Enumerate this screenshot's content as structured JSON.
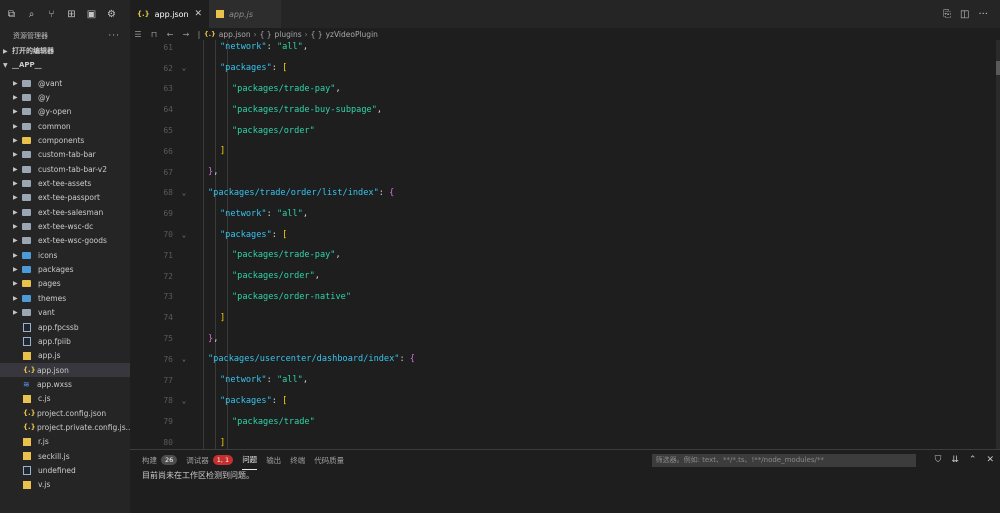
{
  "sidebar": {
    "toolbar_icons": [
      "copy-icon",
      "search-icon",
      "branch-icon",
      "extensions-icon",
      "panel-icon",
      "debug-icon"
    ],
    "header_title": "资源管理器",
    "header_more": "···",
    "open_editors_label": "打开的编辑器",
    "project_label": "__APP__",
    "items": [
      {
        "label": "@vant",
        "type": "folder",
        "color": "plain"
      },
      {
        "label": "@y",
        "type": "folder",
        "color": "plain"
      },
      {
        "label": "@y-open",
        "type": "folder",
        "color": "plain"
      },
      {
        "label": "common",
        "type": "folder",
        "color": "plain"
      },
      {
        "label": "components",
        "type": "folder",
        "color": "yellow"
      },
      {
        "label": "custom-tab-bar",
        "type": "folder",
        "color": "plain"
      },
      {
        "label": "custom-tab-bar-v2",
        "type": "folder",
        "color": "plain"
      },
      {
        "label": "ext-tee-assets",
        "type": "folder",
        "color": "plain"
      },
      {
        "label": "ext-tee-passport",
        "type": "folder",
        "color": "plain"
      },
      {
        "label": "ext-tee-salesman",
        "type": "folder",
        "color": "plain"
      },
      {
        "label": "ext-tee-wsc-dc",
        "type": "folder",
        "color": "plain"
      },
      {
        "label": "ext-tee-wsc-goods",
        "type": "folder",
        "color": "plain"
      },
      {
        "label": "icons",
        "type": "folder",
        "color": "blue"
      },
      {
        "label": "packages",
        "type": "folder",
        "color": "blue"
      },
      {
        "label": "pages",
        "type": "folder",
        "color": "yellow"
      },
      {
        "label": "themes",
        "type": "folder",
        "color": "blue"
      },
      {
        "label": "vant",
        "type": "folder",
        "color": "plain"
      },
      {
        "label": "app.fpcssb",
        "type": "file",
        "icon": "doc"
      },
      {
        "label": "app.fpiib",
        "type": "file",
        "icon": "doc"
      },
      {
        "label": "app.js",
        "type": "file",
        "icon": "js"
      },
      {
        "label": "app.json",
        "type": "file",
        "icon": "json",
        "selected": true
      },
      {
        "label": "app.wxss",
        "type": "file",
        "icon": "wxss"
      },
      {
        "label": "c.js",
        "type": "file",
        "icon": "js"
      },
      {
        "label": "project.config.json",
        "type": "file",
        "icon": "json"
      },
      {
        "label": "project.private.config.js...",
        "type": "file",
        "icon": "json"
      },
      {
        "label": "r.js",
        "type": "file",
        "icon": "js"
      },
      {
        "label": "seckill.js",
        "type": "file",
        "icon": "js"
      },
      {
        "label": "undefined",
        "type": "file",
        "icon": "doc"
      },
      {
        "label": "v.js",
        "type": "file",
        "icon": "js"
      }
    ]
  },
  "tabs": {
    "active": {
      "label": "app.json",
      "icon": "{.}"
    },
    "inactive": {
      "label": "app.js"
    }
  },
  "breadcrumb": {
    "file": "app.json",
    "file_icon": "{.}",
    "parts": [
      "plugins",
      "yzVideoPlugin"
    ],
    "obj_icon": "{ }"
  },
  "editor": {
    "lines": [
      {
        "n": "61",
        "fold": "",
        "indent": 2,
        "tokens": [
          [
            "s-key",
            "\"network\""
          ],
          [
            "punc",
            ": "
          ],
          [
            "s-val",
            "\"all\""
          ],
          [
            "punc",
            ","
          ]
        ]
      },
      {
        "n": "62",
        "fold": "v",
        "indent": 2,
        "tokens": [
          [
            "s-key",
            "\"packages\""
          ],
          [
            "punc",
            ": "
          ],
          [
            "brk2",
            "["
          ]
        ]
      },
      {
        "n": "63",
        "fold": "",
        "indent": 3,
        "tokens": [
          [
            "s-val",
            "\"packages/trade-pay\""
          ],
          [
            "punc",
            ","
          ]
        ]
      },
      {
        "n": "64",
        "fold": "",
        "indent": 3,
        "tokens": [
          [
            "s-val",
            "\"packages/trade-buy-subpage\""
          ],
          [
            "punc",
            ","
          ]
        ]
      },
      {
        "n": "65",
        "fold": "",
        "indent": 3,
        "tokens": [
          [
            "s-val",
            "\"packages/order\""
          ]
        ]
      },
      {
        "n": "66",
        "fold": "",
        "indent": 2,
        "tokens": [
          [
            "brk2",
            "]"
          ]
        ]
      },
      {
        "n": "67",
        "fold": "",
        "indent": 1,
        "tokens": [
          [
            "brk1",
            "}"
          ],
          [
            "punc",
            ","
          ]
        ]
      },
      {
        "n": "68",
        "fold": "v",
        "indent": 1,
        "tokens": [
          [
            "s-key",
            "\"packages/trade/order/list/index\""
          ],
          [
            "punc",
            ": "
          ],
          [
            "brk1",
            "{"
          ]
        ]
      },
      {
        "n": "69",
        "fold": "",
        "indent": 2,
        "tokens": [
          [
            "s-key",
            "\"network\""
          ],
          [
            "punc",
            ": "
          ],
          [
            "s-val",
            "\"all\""
          ],
          [
            "punc",
            ","
          ]
        ]
      },
      {
        "n": "70",
        "fold": "v",
        "indent": 2,
        "tokens": [
          [
            "s-key",
            "\"packages\""
          ],
          [
            "punc",
            ": "
          ],
          [
            "brk2",
            "["
          ]
        ]
      },
      {
        "n": "71",
        "fold": "",
        "indent": 3,
        "tokens": [
          [
            "s-val",
            "\"packages/trade-pay\""
          ],
          [
            "punc",
            ","
          ]
        ]
      },
      {
        "n": "72",
        "fold": "",
        "indent": 3,
        "tokens": [
          [
            "s-val",
            "\"packages/order\""
          ],
          [
            "punc",
            ","
          ]
        ]
      },
      {
        "n": "73",
        "fold": "",
        "indent": 3,
        "tokens": [
          [
            "s-val",
            "\"packages/order-native\""
          ]
        ]
      },
      {
        "n": "74",
        "fold": "",
        "indent": 2,
        "tokens": [
          [
            "brk2",
            "]"
          ]
        ]
      },
      {
        "n": "75",
        "fold": "",
        "indent": 1,
        "tokens": [
          [
            "brk1",
            "}"
          ],
          [
            "punc",
            ","
          ]
        ]
      },
      {
        "n": "76",
        "fold": "v",
        "indent": 1,
        "tokens": [
          [
            "s-key",
            "\"packages/usercenter/dashboard/index\""
          ],
          [
            "punc",
            ": "
          ],
          [
            "brk1",
            "{"
          ]
        ]
      },
      {
        "n": "77",
        "fold": "",
        "indent": 2,
        "tokens": [
          [
            "s-key",
            "\"network\""
          ],
          [
            "punc",
            ": "
          ],
          [
            "s-val",
            "\"all\""
          ],
          [
            "punc",
            ","
          ]
        ]
      },
      {
        "n": "78",
        "fold": "v",
        "indent": 2,
        "tokens": [
          [
            "s-key",
            "\"packages\""
          ],
          [
            "punc",
            ": "
          ],
          [
            "brk2",
            "["
          ]
        ]
      },
      {
        "n": "79",
        "fold": "",
        "indent": 3,
        "tokens": [
          [
            "s-val",
            "\"packages/trade\""
          ]
        ]
      },
      {
        "n": "80",
        "fold": "",
        "indent": 2,
        "tokens": [
          [
            "brk2",
            "]"
          ]
        ]
      }
    ]
  },
  "panel": {
    "tabs": [
      {
        "label": "构建",
        "badge": "26",
        "badge_color": "gray"
      },
      {
        "label": "调试器",
        "badge": "1, 1",
        "badge_color": "red"
      },
      {
        "label": "问题",
        "active": true
      },
      {
        "label": "输出"
      },
      {
        "label": "终端"
      },
      {
        "label": "代码质量"
      }
    ],
    "filter_placeholder": "筛选器。例如: text、**/*.ts、!**/node_modules/**",
    "message": "目前尚未在工作区检测到问题。"
  }
}
